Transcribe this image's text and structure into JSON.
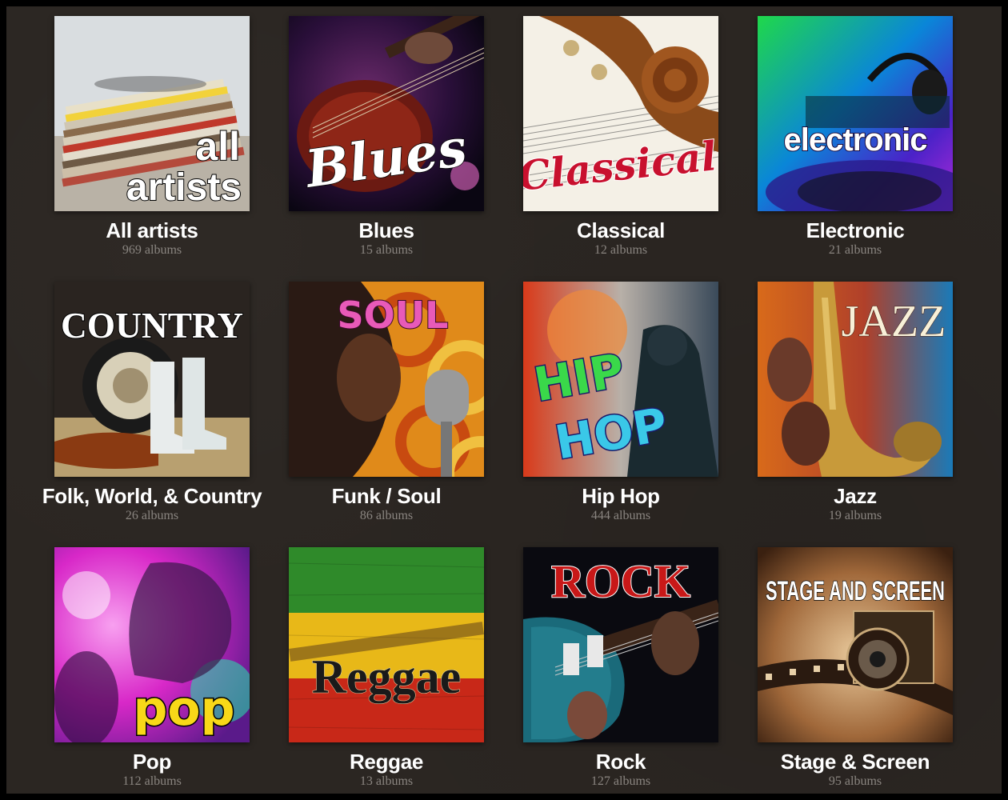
{
  "genres": [
    {
      "name": "All artists",
      "count": "969 albums",
      "cover_text": [
        "all",
        "artists"
      ]
    },
    {
      "name": "Blues",
      "count": "15 albums",
      "cover_text": [
        "Blues"
      ]
    },
    {
      "name": "Classical",
      "count": "12 albums",
      "cover_text": [
        "Classical"
      ]
    },
    {
      "name": "Electronic",
      "count": "21 albums",
      "cover_text": [
        "electronic"
      ]
    },
    {
      "name": "Folk, World, & Country",
      "count": "26 albums",
      "cover_text": [
        "COUNTRY"
      ]
    },
    {
      "name": "Funk / Soul",
      "count": "86 albums",
      "cover_text": [
        "SOUL"
      ]
    },
    {
      "name": "Hip Hop",
      "count": "444 albums",
      "cover_text": [
        "HIP",
        "HOP"
      ]
    },
    {
      "name": "Jazz",
      "count": "19 albums",
      "cover_text": [
        "JAZZ"
      ]
    },
    {
      "name": "Pop",
      "count": "112 albums",
      "cover_text": [
        "pop"
      ]
    },
    {
      "name": "Reggae",
      "count": "13 albums",
      "cover_text": [
        "Reggae"
      ]
    },
    {
      "name": "Rock",
      "count": "127 albums",
      "cover_text": [
        "ROCK"
      ]
    },
    {
      "name": "Stage & Screen",
      "count": "95 albums",
      "cover_text": [
        "STAGE AND SCREEN"
      ]
    }
  ]
}
